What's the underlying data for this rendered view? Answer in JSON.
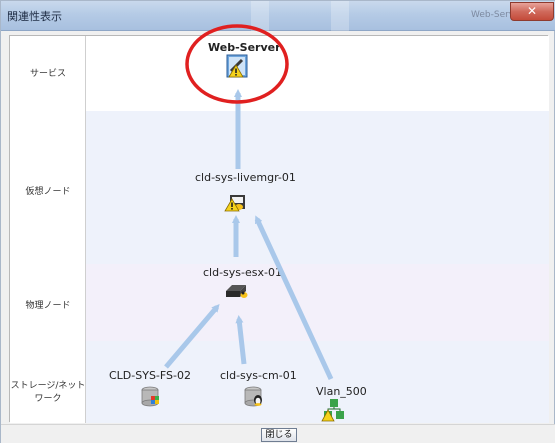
{
  "window": {
    "title": "関連性表示",
    "ghost_title": "Web-Server"
  },
  "lanes": [
    {
      "label": "サービス"
    },
    {
      "label": "仮想ノード"
    },
    {
      "label": "物理ノード"
    },
    {
      "label": "ストレージ/ネットワーク"
    }
  ],
  "nodes": {
    "web_server": {
      "label": "Web-Server",
      "icon": "service-warning-icon"
    },
    "livemgr": {
      "label": "cld-sys-livemgr-01",
      "icon": "virtual-node-warning-icon"
    },
    "esx": {
      "label": "cld-sys-esx-01",
      "icon": "physical-node-icon"
    },
    "fs": {
      "label": "CLD-SYS-FS-02",
      "icon": "storage-icon"
    },
    "cm": {
      "label": "cld-sys-cm-01",
      "icon": "storage-linux-icon"
    },
    "vlan": {
      "label": "Vlan_500",
      "icon": "network-warning-icon"
    }
  },
  "footer": {
    "close_label": "閉じる"
  },
  "colors": {
    "arrow": "#a9c8ea",
    "lane_service": "#ffffff",
    "lane_virtual": "#eef2fb",
    "lane_physical": "#f2effa",
    "lane_storage": "#eef2fb",
    "highlight_circle": "#e02020"
  }
}
